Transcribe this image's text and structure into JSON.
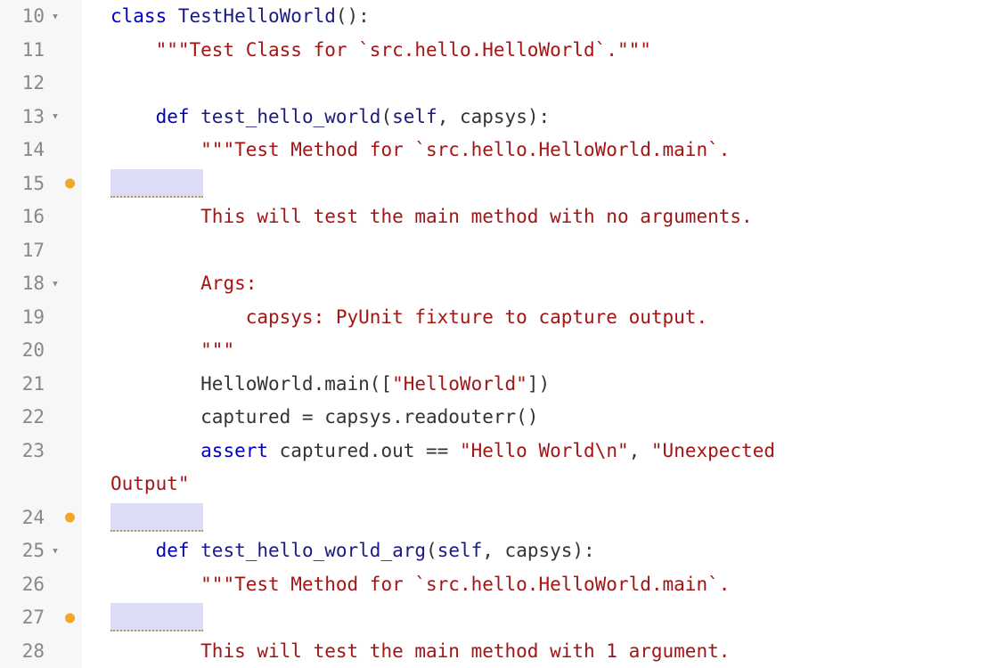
{
  "colors": {
    "keyword": "#0000c0",
    "identifier_blue": "#1a1a80",
    "string": "#a31515",
    "gutter_bg": "#f7f7f7",
    "gutter_fg": "#888888",
    "ws_highlight_bg": "#dcdcf7",
    "lint_dot": "#f5a623"
  },
  "gutter": {
    "line_numbers": [
      "10",
      "11",
      "12",
      "13",
      "14",
      "15",
      "16",
      "17",
      "18",
      "19",
      "20",
      "21",
      "22",
      "23",
      "24",
      "25",
      "26",
      "27",
      "28"
    ],
    "fold_markers": {
      "10": "▾",
      "13": "▾",
      "18": "▾",
      "25": "▾"
    },
    "lint_dots": [
      "15",
      "24",
      "27"
    ],
    "fold_glyph": "▾"
  },
  "code": {
    "lines": [
      {
        "n": 10,
        "tokens": [
          {
            "t": "class ",
            "c": "tk-kw"
          },
          {
            "t": "TestHelloWorld",
            "c": "tk-cls"
          },
          {
            "t": "():",
            "c": "tk-punc"
          }
        ]
      },
      {
        "n": 11,
        "tokens": [
          {
            "t": "    ",
            "c": ""
          },
          {
            "t": "\"\"\"Test Class for `src.hello.HelloWorld`.\"\"\"",
            "c": "tk-str"
          }
        ]
      },
      {
        "n": 12,
        "tokens": []
      },
      {
        "n": 13,
        "tokens": [
          {
            "t": "    ",
            "c": ""
          },
          {
            "t": "def ",
            "c": "tk-kw"
          },
          {
            "t": "test_hello_world",
            "c": "tk-fn"
          },
          {
            "t": "(",
            "c": "tk-punc"
          },
          {
            "t": "self",
            "c": "tk-self"
          },
          {
            "t": ", capsys):",
            "c": "tk-punc"
          }
        ]
      },
      {
        "n": 14,
        "tokens": [
          {
            "t": "        ",
            "c": ""
          },
          {
            "t": "\"\"\"Test Method for `src.hello.HelloWorld.main`.",
            "c": "tk-str"
          }
        ]
      },
      {
        "n": 15,
        "ws_block": true,
        "tokens": []
      },
      {
        "n": 16,
        "tokens": [
          {
            "t": "        ",
            "c": ""
          },
          {
            "t": "This will test the main method with no arguments.",
            "c": "tk-str"
          }
        ]
      },
      {
        "n": 17,
        "tokens": []
      },
      {
        "n": 18,
        "tokens": [
          {
            "t": "        ",
            "c": ""
          },
          {
            "t": "Args:",
            "c": "tk-str"
          }
        ]
      },
      {
        "n": 19,
        "tokens": [
          {
            "t": "            ",
            "c": ""
          },
          {
            "t": "capsys: PyUnit fixture to capture output.",
            "c": "tk-str"
          }
        ]
      },
      {
        "n": 20,
        "tokens": [
          {
            "t": "        ",
            "c": ""
          },
          {
            "t": "\"\"\"",
            "c": "tk-str"
          }
        ]
      },
      {
        "n": 21,
        "tokens": [
          {
            "t": "        HelloWorld.main([",
            "c": "tk-ident"
          },
          {
            "t": "\"HelloWorld\"",
            "c": "tk-str"
          },
          {
            "t": "])",
            "c": "tk-ident"
          }
        ]
      },
      {
        "n": 22,
        "tokens": [
          {
            "t": "        captured = capsys.readouterr()",
            "c": "tk-ident"
          }
        ]
      },
      {
        "n": 23,
        "tokens": [
          {
            "t": "        ",
            "c": ""
          },
          {
            "t": "assert",
            "c": "tk-kw"
          },
          {
            "t": " captured.out == ",
            "c": "tk-ident"
          },
          {
            "t": "\"Hello World\\n\"",
            "c": "tk-str"
          },
          {
            "t": ", ",
            "c": "tk-ident"
          },
          {
            "t": "\"Unexpected ",
            "c": "tk-str"
          }
        ],
        "wrap_tokens": [
          {
            "t": "Output\"",
            "c": "tk-str"
          }
        ]
      },
      {
        "n": 24,
        "ws_block": true,
        "tokens": []
      },
      {
        "n": 25,
        "tokens": [
          {
            "t": "    ",
            "c": ""
          },
          {
            "t": "def ",
            "c": "tk-kw"
          },
          {
            "t": "test_hello_world_arg",
            "c": "tk-fn"
          },
          {
            "t": "(",
            "c": "tk-punc"
          },
          {
            "t": "self",
            "c": "tk-self"
          },
          {
            "t": ", capsys):",
            "c": "tk-punc"
          }
        ]
      },
      {
        "n": 26,
        "tokens": [
          {
            "t": "        ",
            "c": ""
          },
          {
            "t": "\"\"\"Test Method for `src.hello.HelloWorld.main`.",
            "c": "tk-str"
          }
        ]
      },
      {
        "n": 27,
        "ws_block": true,
        "tokens": []
      },
      {
        "n": 28,
        "tokens": [
          {
            "t": "        ",
            "c": ""
          },
          {
            "t": "This will test the main method with 1 argument.",
            "c": "tk-str"
          }
        ]
      }
    ]
  }
}
